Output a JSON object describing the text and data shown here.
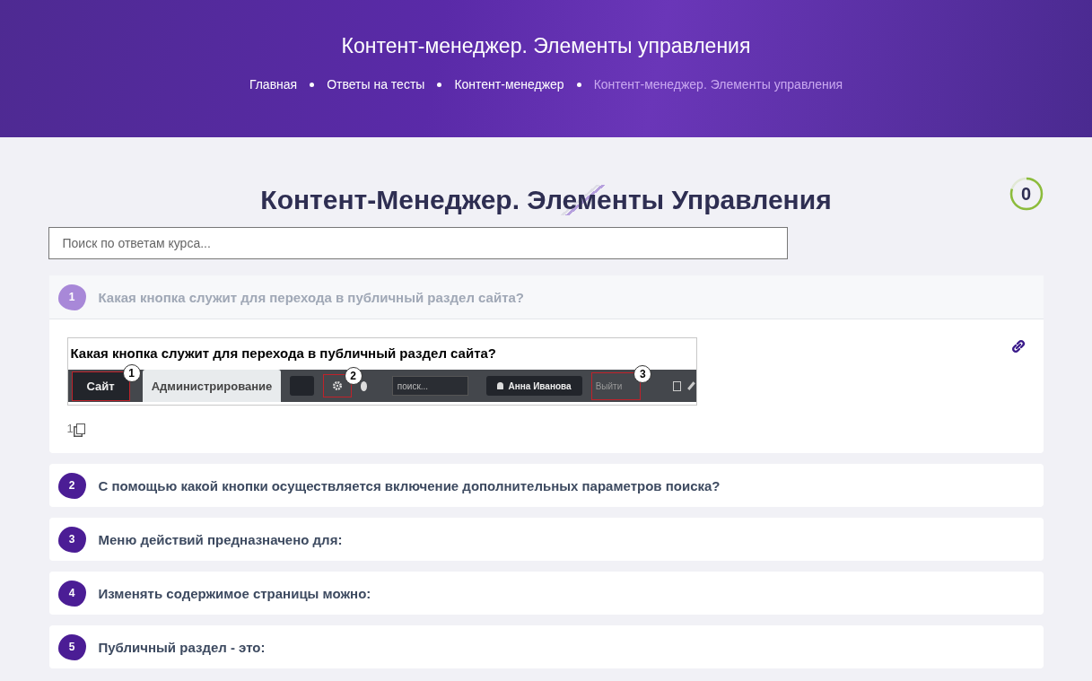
{
  "hero": {
    "title": "Контент-менеджер. Элементы управления",
    "breadcrumbs": [
      {
        "label": "Главная",
        "current": false
      },
      {
        "label": "Ответы на тесты",
        "current": false
      },
      {
        "label": "Контент-менеджер",
        "current": false
      },
      {
        "label": "Контент-менеджер. Элементы управления",
        "current": true
      }
    ]
  },
  "page_title": "Контент-Менеджер. Элементы Управления",
  "progress": {
    "value": "0"
  },
  "search": {
    "placeholder": "Поиск по ответам курса..."
  },
  "questions": [
    {
      "number": "1",
      "text": "Какая кнопка служит для перехода в публичный раздел сайта?",
      "expanded": true,
      "screenshot": {
        "title": "Какая кнопка служит для перехода в публичный раздел сайта?",
        "site_button": "Сайт",
        "admin_tab": "Администрирование",
        "search_placeholder": "поиск...",
        "user": "Анна Иванова",
        "logout": "Выйти",
        "markers": [
          "1",
          "2",
          "3"
        ]
      },
      "answer": "1"
    },
    {
      "number": "2",
      "text": "С помощью какой кнопки осуществляется включение дополнительных параметров поиска?",
      "expanded": false
    },
    {
      "number": "3",
      "text": "Меню действий предназначено для:",
      "expanded": false
    },
    {
      "number": "4",
      "text": "Изменять содержимое страницы можно:",
      "expanded": false
    },
    {
      "number": "5",
      "text": "Публичный раздел - это:",
      "expanded": false
    }
  ]
}
